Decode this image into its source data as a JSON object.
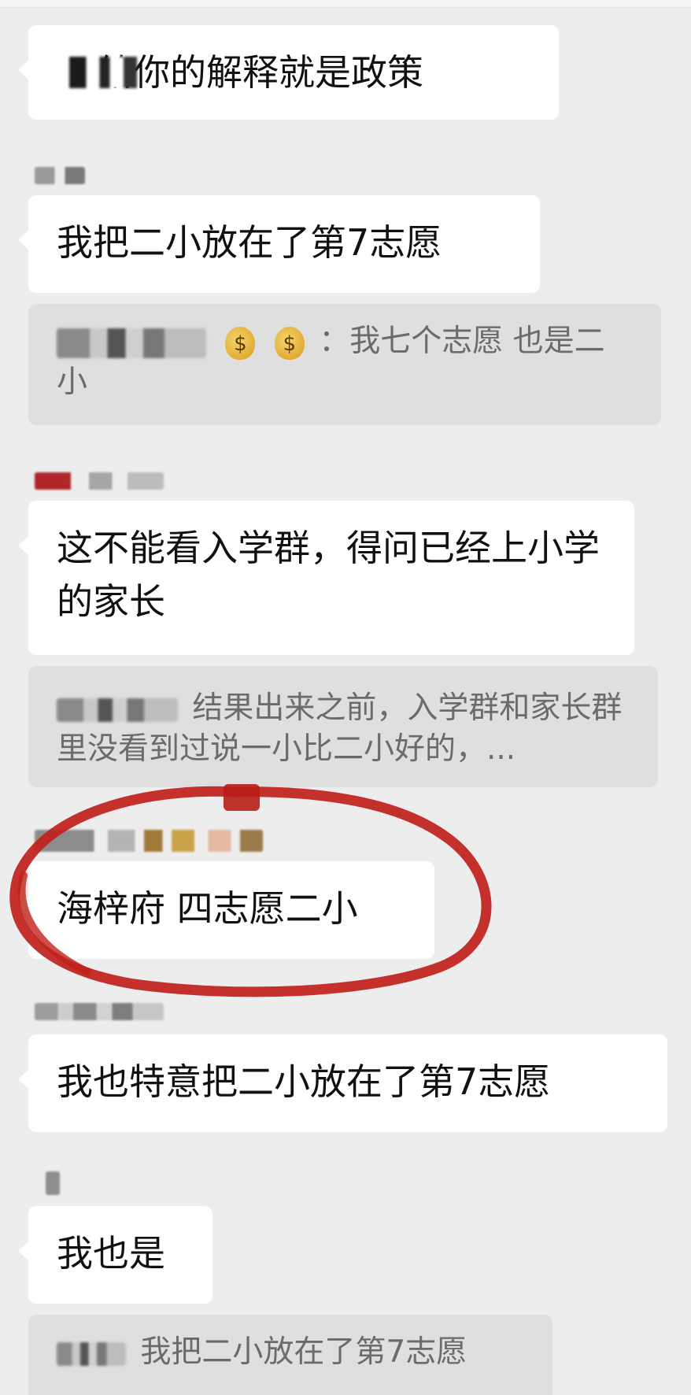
{
  "messages": [
    {
      "text": "给你的解释就是政策"
    },
    {
      "text": "我把二小放在了第7志愿"
    },
    {
      "quote": "：我七个志愿 也是二小"
    },
    {
      "text": "这不能看入学群，得问已经上小学的家长"
    },
    {
      "quote": "结果出来之前，入学群和家长群里没看到过说一小比二小好的，..."
    },
    {
      "text": "海梓府 四志愿二小"
    },
    {
      "text": "我也特意把二小放在了第7志愿"
    },
    {
      "text": "我也是"
    },
    {
      "quote": "我把二小放在了第7志愿"
    }
  ],
  "emoji": {
    "money_bag": "$"
  },
  "colors": {
    "background": "#ededed",
    "bubble": "#ffffff",
    "quote_bg": "#dfdfdf",
    "quote_text": "#6b6b6b",
    "annotation_red": "#c0201a"
  }
}
